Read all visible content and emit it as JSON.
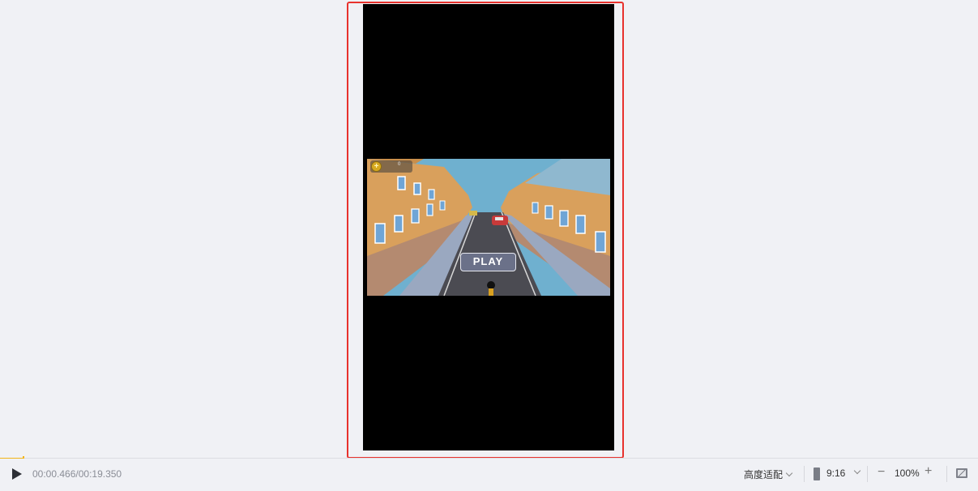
{
  "preview": {
    "game": {
      "play_label": "PLAY",
      "coin_count": "0"
    }
  },
  "player": {
    "time_readout": "00:00.466/00:19.350",
    "progress_fraction": 0.024
  },
  "controls": {
    "fit_mode": "高度适配",
    "aspect_ratio": "9:16",
    "zoom_out_symbol": "−",
    "zoom_level": "100%",
    "zoom_in_symbol": "+"
  },
  "icons": {
    "play": "play-icon",
    "ratio": "portrait-ratio-icon",
    "fullscreen": "fullscreen-icon",
    "coin": "coin-icon"
  },
  "colors": {
    "selection_border": "#e8322d",
    "progress": "#f2b418",
    "background": "#f0f1f5"
  }
}
